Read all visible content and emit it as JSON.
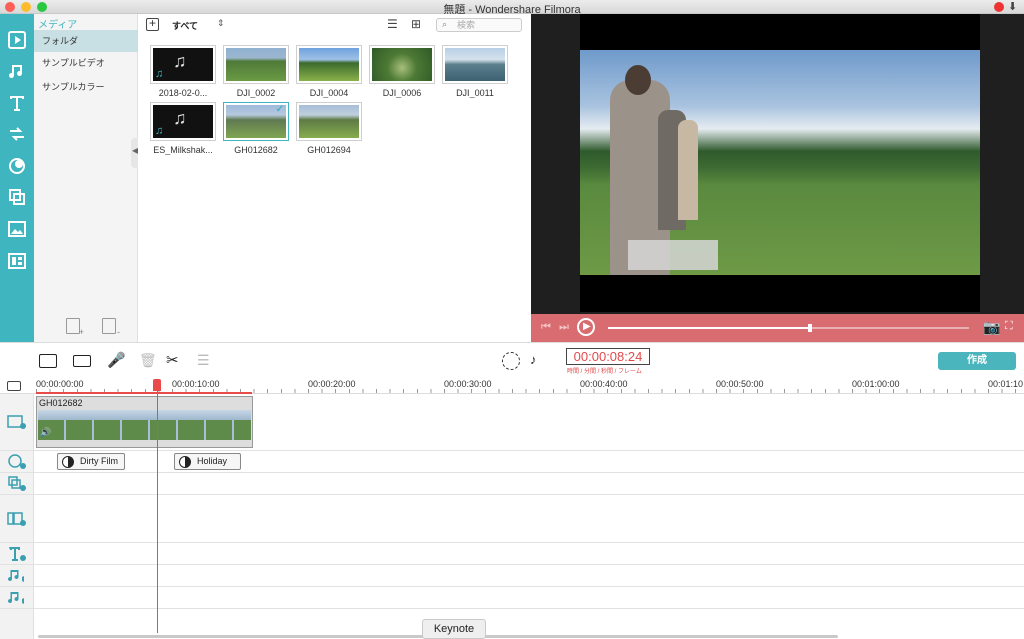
{
  "window": {
    "title": "無題 - Wondershare Filmora"
  },
  "sidebar": {
    "header": "メディア",
    "items": [
      {
        "label": "フォルダ",
        "selected": true
      },
      {
        "label": "サンプルビデオ"
      },
      {
        "label": "サンプルカラー"
      }
    ]
  },
  "media_toolbar": {
    "filter": "すべて",
    "search_placeholder": "検索"
  },
  "media_items": [
    {
      "label": "2018-02-0...",
      "kind": "audio"
    },
    {
      "label": "DJI_0002",
      "kind": "video"
    },
    {
      "label": "DJI_0004",
      "kind": "video"
    },
    {
      "label": "DJI_0006",
      "kind": "video"
    },
    {
      "label": "DJI_0011",
      "kind": "video"
    },
    {
      "label": "ES_Milkshak...",
      "kind": "audio"
    },
    {
      "label": "GH012682",
      "kind": "video",
      "checked": true
    },
    {
      "label": "GH012694",
      "kind": "video"
    }
  ],
  "playback": {
    "progress": 0.56
  },
  "toolbar": {
    "timecode": "00:00:08:24",
    "timecode_caption": "時間 / 分間 / 秒間 / フレーム",
    "export_label": "作成"
  },
  "ruler": {
    "labels": [
      "00:00:00:00",
      "00:00:10:00",
      "00:00:20:00",
      "00:00:30:00",
      "00:00:40:00",
      "00:00:50:00",
      "00:01:00:00",
      "00:01:10"
    ]
  },
  "timeline": {
    "clip_name": "GH012682",
    "effects": [
      "Dirty Film",
      "Holiday"
    ]
  },
  "dock_tooltip": "Keynote",
  "colors": {
    "accent": "#3fb5bf",
    "playhead": "#e94b4b",
    "controls_bar": "#d86c70",
    "export_button": "#4bb5bd"
  }
}
